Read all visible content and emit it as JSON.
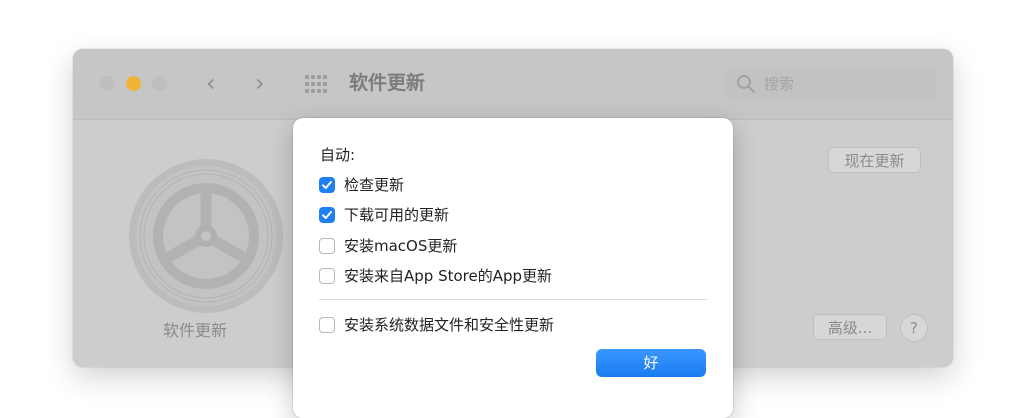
{
  "window": {
    "title": "软件更新",
    "search": {
      "placeholder": "搜索"
    },
    "pane_label": "软件更新",
    "update_now_label": "现在更新",
    "advanced_label": "高级...",
    "help_label": "?"
  },
  "dialog": {
    "heading": "自动:",
    "options": [
      {
        "label": "检查更新",
        "checked": true
      },
      {
        "label": "下载可用的更新",
        "checked": true
      },
      {
        "label": "安装macOS更新",
        "checked": false
      },
      {
        "label": "安装来自App Store的App更新",
        "checked": false
      },
      {
        "label": "安装系统数据文件和安全性更新",
        "checked": false
      }
    ],
    "ok_label": "好"
  },
  "icons": {
    "back": "chevron-left-icon",
    "forward": "chevron-right-icon",
    "show_all": "grid-icon",
    "search": "search-icon",
    "pane": "gear-icon"
  },
  "colors": {
    "accent": "#1f7ff4",
    "minimize": "#f2b437"
  }
}
